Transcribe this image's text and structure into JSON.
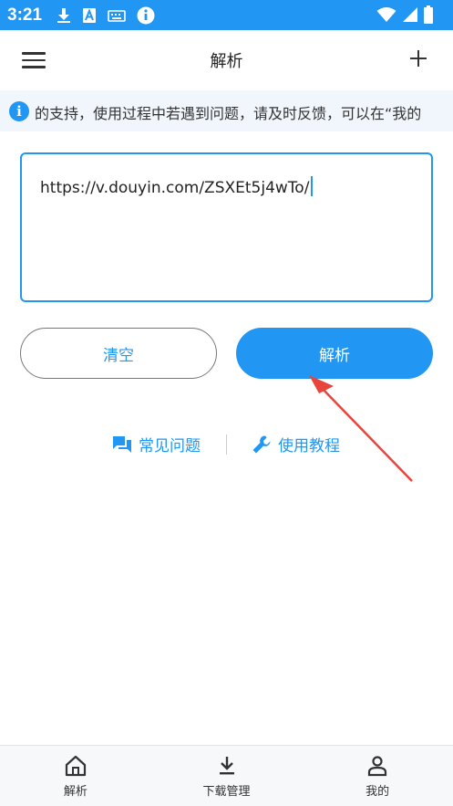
{
  "status_bar": {
    "time": "3:21",
    "left_icons": [
      "download-icon",
      "text-a-icon",
      "keyboard-icon",
      "info-icon"
    ],
    "right_icons": [
      "wifi-icon",
      "signal-icon",
      "battery-icon"
    ],
    "color": "#2196f3"
  },
  "appbar": {
    "title": "解析",
    "menu_icon": "hamburger-menu-icon",
    "add_icon": "plus-icon"
  },
  "notice": {
    "icon": "info-icon",
    "text": "的支持，使用过程中若遇到问题，请及时反馈，可以在“我的"
  },
  "input": {
    "value": "https://v.douyin.com/ZSXEt5j4wTo/"
  },
  "buttons": {
    "clear_label": "清空",
    "parse_label": "解析"
  },
  "links": {
    "faq_label": "常见问题",
    "faq_icon": "chat-bubbles-icon",
    "tutorial_label": "使用教程",
    "tutorial_icon": "wrench-icon"
  },
  "bottom_nav": {
    "items": [
      {
        "label": "解析",
        "icon": "home-icon"
      },
      {
        "label": "下载管理",
        "icon": "download-tray-icon"
      },
      {
        "label": "我的",
        "icon": "person-icon"
      }
    ]
  },
  "colors": {
    "accent": "#2196f3",
    "arrow": "#e8453c"
  }
}
